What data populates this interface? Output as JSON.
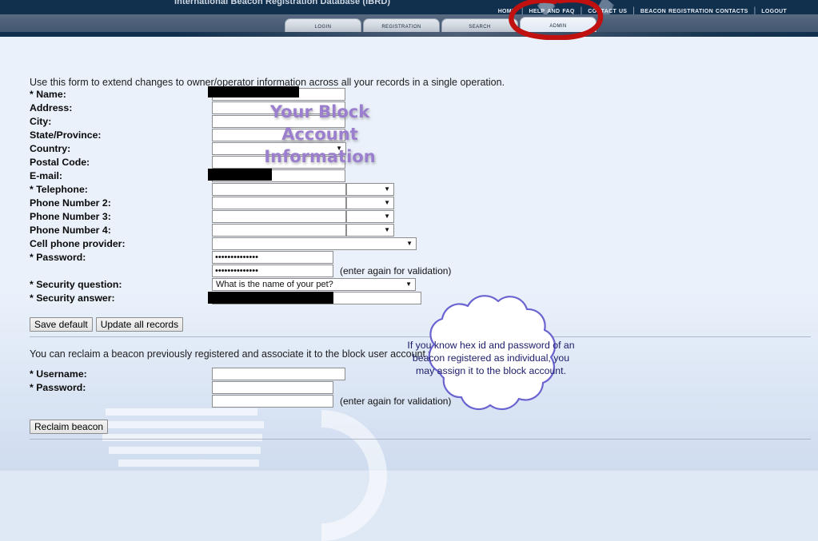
{
  "site": {
    "title": "International Beacon Registration Database (IBRD)"
  },
  "topnav": {
    "items": [
      {
        "label": "Home",
        "name": "home"
      },
      {
        "label": "Help and FAQ",
        "name": "help-and-faq"
      },
      {
        "label": "Contact Us",
        "name": "contact-us"
      },
      {
        "label": "Beacon Registration Contacts",
        "name": "beacon-registration-contacts"
      },
      {
        "label": "Logout",
        "name": "logout"
      }
    ],
    "separator": "|"
  },
  "tabs": [
    {
      "label": "Login",
      "name": "login",
      "active": false
    },
    {
      "label": "Registration",
      "name": "registration",
      "active": false
    },
    {
      "label": "Search",
      "name": "search",
      "active": false
    },
    {
      "label": "Admin",
      "name": "admin",
      "active": true
    }
  ],
  "block_account": {
    "intro": "Use this form to extend changes to owner/operator information across all your records in a single operation.",
    "fields": {
      "name_label": "* Name:",
      "name_value": "",
      "address_label": "Address:",
      "address_value": "",
      "city_label": "City:",
      "city_value": "",
      "state_label": "State/Province:",
      "state_value": "",
      "country_label": "Country:",
      "country_value": "",
      "postal_label": "Postal Code:",
      "postal_value": "",
      "email_label": "E-mail:",
      "email_value": "",
      "telephone_label": "* Telephone:",
      "telephone_value": "",
      "telephone_type": "",
      "phone2_label": "Phone Number 2:",
      "phone2_value": "",
      "phone2_type": "",
      "phone3_label": "Phone Number 3:",
      "phone3_value": "",
      "phone3_type": "",
      "phone4_label": "Phone Number 4:",
      "phone4_value": "",
      "phone4_type": "",
      "cell_provider_label": "Cell phone provider:",
      "cell_provider_value": "",
      "password_label": "* Password:",
      "password_value": "••••••••••••••",
      "password_confirm_value": "••••••••••••••",
      "password_confirm_hint": "(enter again for validation)",
      "security_question_label": "* Security question:",
      "security_question_value": "What is the name of your pet?",
      "security_answer_label": "* Security answer:",
      "security_answer_value": ""
    },
    "buttons": {
      "save_default": "Save default",
      "update_all": "Update all records"
    }
  },
  "reclaim": {
    "intro": "You can reclaim a beacon previously registered and associate it to the block user account you are logged in.",
    "username_label": "* Username:",
    "username_value": "",
    "password_label": "* Password:",
    "password_value": "",
    "password_confirm_value": "",
    "password_confirm_hint": "(enter again for validation)",
    "button": "Reclaim beacon"
  },
  "annotations": {
    "watermark_text": "Your Block Account Information",
    "callout_text": "If you know hex id and password of an beacon registered as individual, you may assign it to the block account.",
    "circle_target": "Admin tab",
    "circle_color": "#c01010",
    "watermark_color": "#9b7ece",
    "callout_border_color": "#6a63d0"
  },
  "icons": {
    "caret_down": "▼"
  }
}
